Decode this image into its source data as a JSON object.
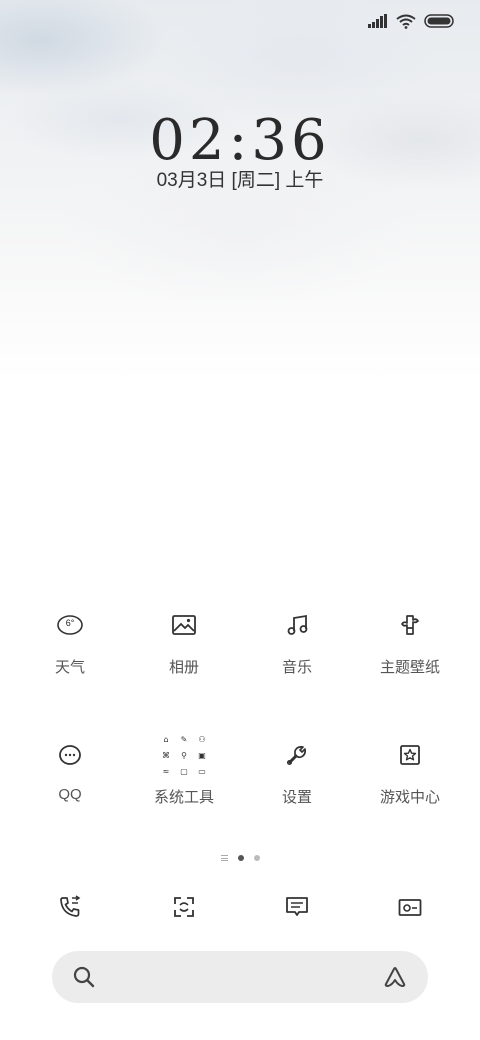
{
  "lockscreen": {
    "time": "02:36",
    "date": "03月3日 [周二] 上午"
  },
  "status_bar": {
    "icons": [
      "signal-icon",
      "wifi-icon",
      "battery-icon"
    ]
  },
  "apps": [
    {
      "label": "天气",
      "icon": "weather-icon",
      "temp": "6°"
    },
    {
      "label": "相册",
      "icon": "gallery-icon"
    },
    {
      "label": "音乐",
      "icon": "music-icon"
    },
    {
      "label": "主题壁纸",
      "icon": "theme-icon"
    },
    {
      "label": "QQ",
      "icon": "qq-icon"
    },
    {
      "label": "系统工具",
      "icon": "folder-icon"
    },
    {
      "label": "设置",
      "icon": "settings-icon"
    },
    {
      "label": "游戏中心",
      "icon": "game-center-icon"
    }
  ],
  "page_indicator": {
    "pages": 3,
    "active": 1
  },
  "dock": [
    {
      "icon": "phone-icon"
    },
    {
      "icon": "screen-capture-icon"
    },
    {
      "icon": "messages-icon"
    },
    {
      "icon": "camera-icon"
    }
  ],
  "search_bar": {
    "left_icon": "search-icon",
    "right_icon": "assistant-icon"
  }
}
